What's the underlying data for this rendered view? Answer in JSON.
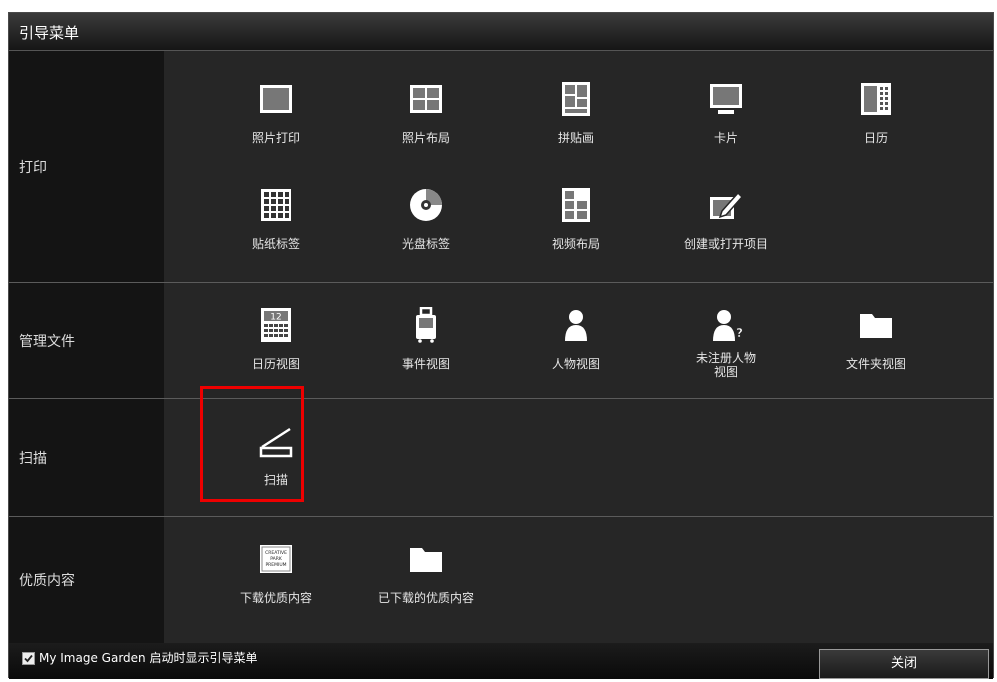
{
  "window": {
    "title": "引导菜单"
  },
  "sections": {
    "print": {
      "label": "打印",
      "items": [
        {
          "label": "照片打印",
          "icon": "photo-print-icon"
        },
        {
          "label": "照片布局",
          "icon": "photo-layout-icon"
        },
        {
          "label": "拼贴画",
          "icon": "collage-icon"
        },
        {
          "label": "卡片",
          "icon": "card-icon"
        },
        {
          "label": "日历",
          "icon": "calendar-icon"
        },
        {
          "label": "贴纸标签",
          "icon": "sticker-icon"
        },
        {
          "label": "光盘标签",
          "icon": "disc-label-icon"
        },
        {
          "label": "视频布局",
          "icon": "video-layout-icon"
        },
        {
          "label": "创建或打开项目",
          "icon": "create-open-item-icon"
        }
      ]
    },
    "manage": {
      "label": "管理文件",
      "items": [
        {
          "label": "日历视图",
          "icon": "calendar-view-icon",
          "badge": "12"
        },
        {
          "label": "事件视图",
          "icon": "event-view-icon"
        },
        {
          "label": "人物视图",
          "icon": "people-view-icon"
        },
        {
          "label": "未注册人物\n视图",
          "icon": "unregistered-people-icon"
        },
        {
          "label": "文件夹视图",
          "icon": "folder-view-icon"
        }
      ]
    },
    "scan": {
      "label": "扫描",
      "items": [
        {
          "label": "扫描",
          "icon": "scan-icon"
        }
      ]
    },
    "premium": {
      "label": "优质内容",
      "items": [
        {
          "label": "下载优质内容",
          "icon": "creative-park-icon",
          "icon_text": [
            "CREATIVE",
            "PARK",
            "PREMIUM"
          ]
        },
        {
          "label": "已下载的优质内容",
          "icon": "folder-icon"
        }
      ]
    }
  },
  "footer": {
    "checkbox_label": "My Image Garden 启动时显示引导菜单",
    "checkbox_checked": true,
    "close_label": "关闭"
  },
  "colors": {
    "highlight": "#ee0000",
    "background": "#262626"
  }
}
